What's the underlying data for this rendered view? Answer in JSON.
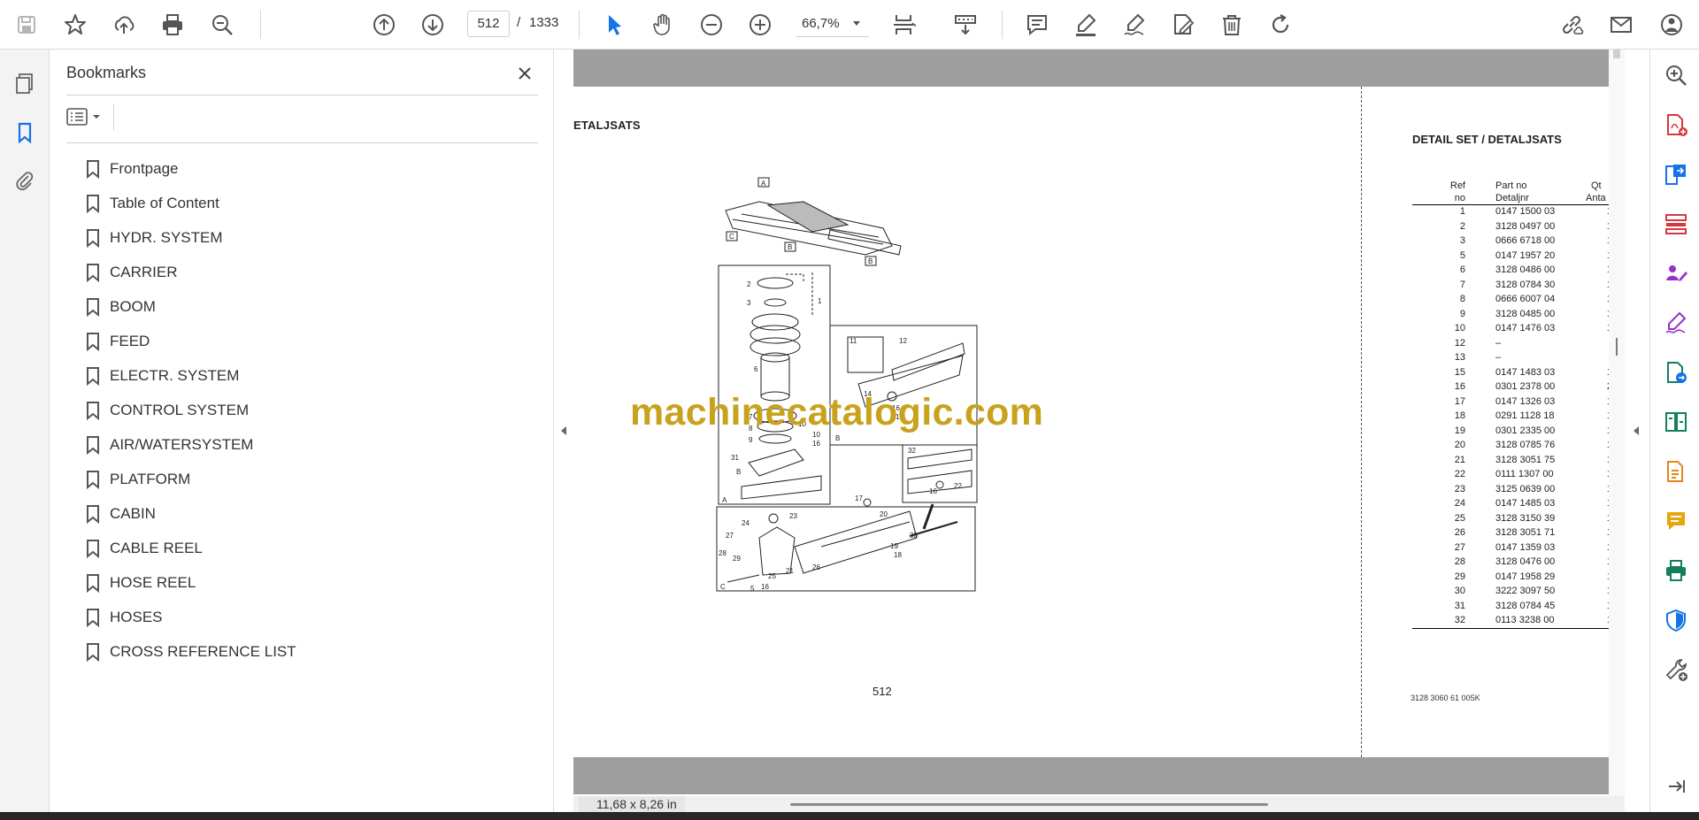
{
  "toolbar": {
    "page_current": "512",
    "page_separator": "/",
    "page_total": "1333",
    "zoom": "66,7%",
    "icons": [
      "save-icon",
      "star-icon",
      "upload-icon",
      "print-icon",
      "search-zoom-icon",
      "page-up-icon",
      "page-down-icon",
      "select-cursor-icon",
      "hand-icon",
      "zoom-out-icon",
      "zoom-in-icon",
      "fit-page-icon",
      "scroll-mode-icon",
      "comment-icon",
      "highlight-icon",
      "sign-icon",
      "edit-icon",
      "delete-icon",
      "rotate-icon",
      "link-icon",
      "mail-icon",
      "account-icon"
    ]
  },
  "bookmarks": {
    "title": "Bookmarks",
    "items": [
      "Frontpage",
      "Table of Content",
      "HYDR. SYSTEM",
      "CARRIER",
      "BOOM",
      "FEED",
      "ELECTR. SYSTEM",
      "CONTROL SYSTEM",
      "AIR/WATERSYSTEM",
      "PLATFORM",
      "CABIN",
      "CABLE REEL",
      "HOSE REEL",
      "HOSES",
      "CROSS REFERENCE LIST"
    ]
  },
  "document": {
    "heading_left": "ETALJSATS",
    "heading_right": "DETAIL SET / DETALJSATS",
    "page_number": "512",
    "watermark": "machinecatalogic.com",
    "footer_ref": "3128 3060 61  005K",
    "table": {
      "header_ref": [
        "Ref",
        "no"
      ],
      "header_part": [
        "Part no",
        "Detaljnr"
      ],
      "header_qty": [
        "Qt",
        "Anta"
      ],
      "rows": [
        {
          "ref": "1",
          "part": "0147 1500 03",
          "qty": "1"
        },
        {
          "ref": "2",
          "part": "3128 0497 00",
          "qty": "1"
        },
        {
          "ref": "3",
          "part": "0666 6718 00",
          "qty": "1"
        },
        {
          "ref": "5",
          "part": "0147 1957 20",
          "qty": "1"
        },
        {
          "ref": "6",
          "part": "3128 0486 00",
          "qty": "1"
        },
        {
          "ref": "7",
          "part": "3128 0784 30",
          "qty": "1"
        },
        {
          "ref": "8",
          "part": "0666 6007 04",
          "qty": "1"
        },
        {
          "ref": "9",
          "part": "3128 0485 00",
          "qty": "1"
        },
        {
          "ref": "10",
          "part": "0147 1476 03",
          "qty": "1"
        },
        {
          "ref": "12",
          "part": "–",
          "qty": ""
        },
        {
          "ref": "13",
          "part": "–",
          "qty": ""
        },
        {
          "ref": "15",
          "part": "0147 1483 03",
          "qty": "1"
        },
        {
          "ref": "16",
          "part": "0301 2378 00",
          "qty": "2"
        },
        {
          "ref": "17",
          "part": "0147 1326 03",
          "qty": "1"
        },
        {
          "ref": "18",
          "part": "0291 1128 18",
          "qty": "1"
        },
        {
          "ref": "19",
          "part": "0301 2335 00",
          "qty": "1"
        },
        {
          "ref": "20",
          "part": "3128 0785 76",
          "qty": "1"
        },
        {
          "ref": "21",
          "part": "3128 3051 75",
          "qty": "1"
        },
        {
          "ref": "22",
          "part": "0111 1307 00",
          "qty": "1"
        },
        {
          "ref": "23",
          "part": "3125 0639 00",
          "qty": "1"
        },
        {
          "ref": "24",
          "part": "0147 1485 03",
          "qty": "1"
        },
        {
          "ref": "25",
          "part": "3128 3150 39",
          "qty": "1"
        },
        {
          "ref": "26",
          "part": "3128 3051 71",
          "qty": "1"
        },
        {
          "ref": "27",
          "part": "0147 1359 03",
          "qty": "1"
        },
        {
          "ref": "28",
          "part": "3128 0476 00",
          "qty": "1"
        },
        {
          "ref": "29",
          "part": "0147 1958 29",
          "qty": "1"
        },
        {
          "ref": "30",
          "part": "3222 3097 50",
          "qty": "1"
        },
        {
          "ref": "31",
          "part": "3128 0784 45",
          "qty": "1"
        },
        {
          "ref": "32",
          "part": "0113 3238 00",
          "qty": "1"
        }
      ]
    }
  },
  "status": {
    "page_size": "11,68 x 8,26 in"
  },
  "colors": {
    "accent_blue": "#1473e6",
    "watermark_gold": "#c9a21d",
    "doc_gray": "#9e9e9e"
  }
}
